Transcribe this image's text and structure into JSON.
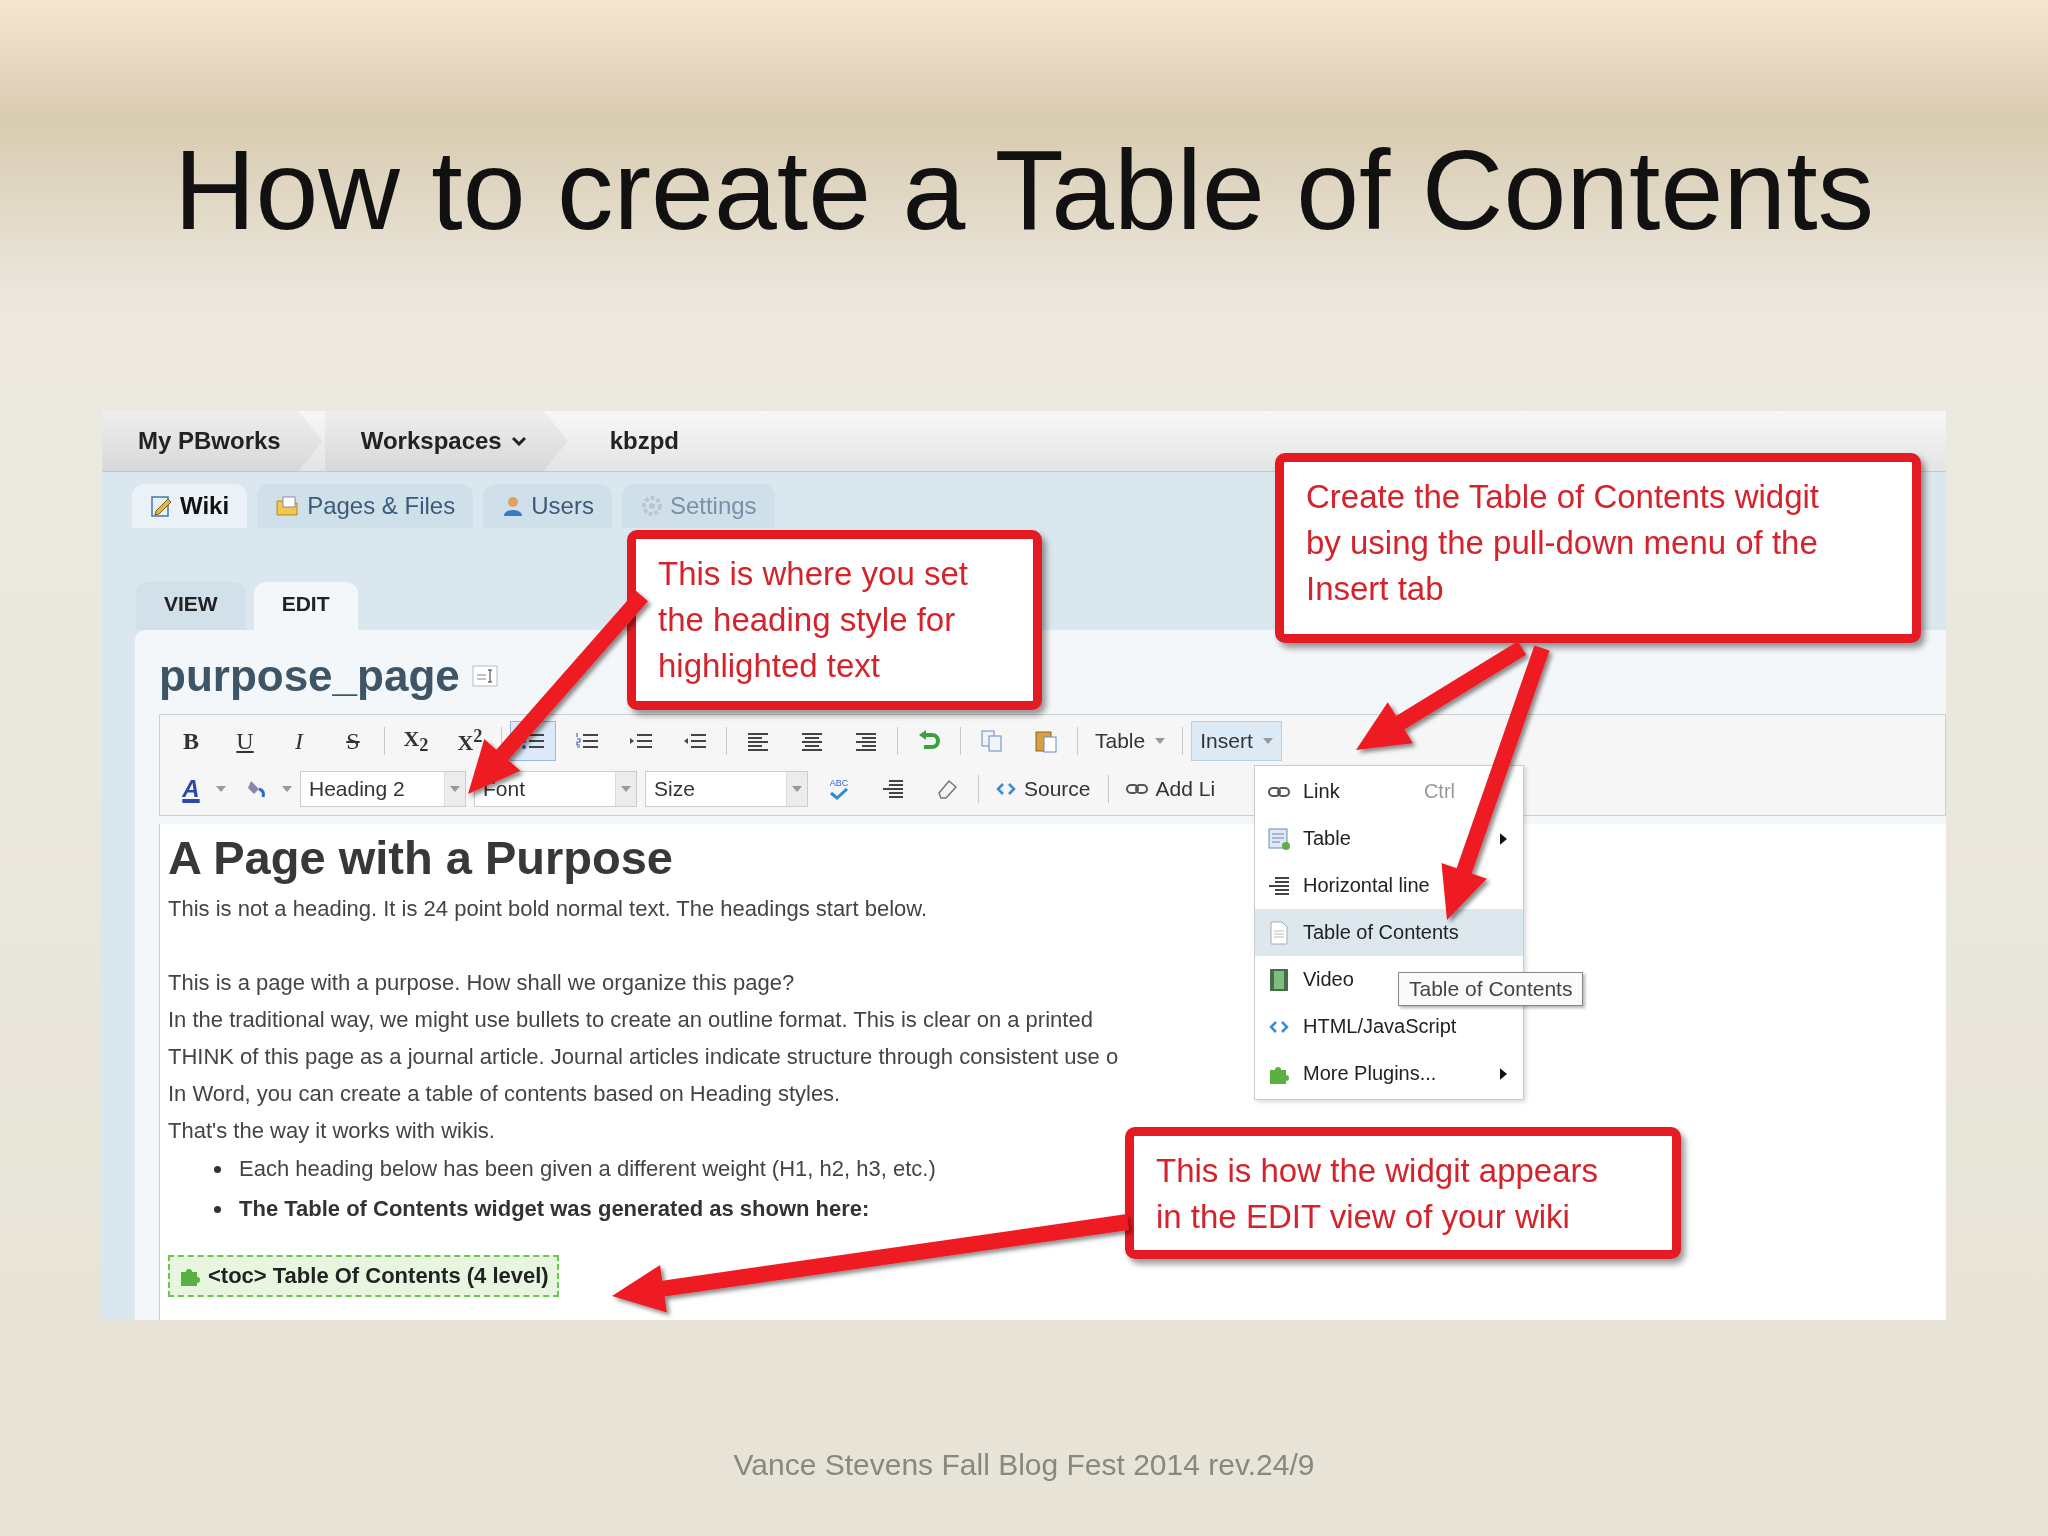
{
  "slide_title": "How to create a Table of Contents",
  "breadcrumbs": [
    {
      "label": "My PBworks",
      "dropdown": false
    },
    {
      "label": "Workspaces",
      "dropdown": true
    },
    {
      "label": "kbzpd",
      "dropdown": false
    }
  ],
  "tabs": [
    {
      "label": "Wiki",
      "selected": true
    },
    {
      "label": "Pages & Files",
      "selected": false
    },
    {
      "label": "Users",
      "selected": false
    },
    {
      "label": "Settings",
      "selected": false
    }
  ],
  "mode_tabs": [
    {
      "label": "VIEW",
      "selected": false
    },
    {
      "label": "EDIT",
      "selected": true
    }
  ],
  "page_title": "purpose_page",
  "toolbar": {
    "format_buttons": [
      {
        "label": "B"
      },
      {
        "label": "U"
      },
      {
        "label": "I"
      },
      {
        "label": "S"
      },
      {
        "label": "X$_{2}$"
      },
      {
        "label": "X$^{2}$"
      }
    ],
    "list_buttons": [
      {
        "selected": true
      },
      {
        "selected": false
      },
      {
        "selected": false
      },
      {
        "selected": false
      }
    ],
    "table_menu": "Table",
    "insert_button": {
      "label": "Insert",
      "expanded": true
    },
    "font_color_button": "A",
    "style_select": "Heading 2",
    "font_select": "Font",
    "size_select": "Size",
    "spellcheck_label": "ABC",
    "source_button": "Source",
    "add_link_button": "Add Li"
  },
  "insert_menu": [
    {
      "label": "Link",
      "shortcut": "Ctrl",
      "submenu": false,
      "selected": false
    },
    {
      "label": "Table",
      "submenu": true,
      "selected": false
    },
    {
      "label": "Horizontal line",
      "submenu": false,
      "selected": false
    },
    {
      "label": "Table of Contents",
      "submenu": false,
      "selected": true
    },
    {
      "label": "Video",
      "submenu": false,
      "selected": false
    },
    {
      "label": "HTML/JavaScript",
      "submenu": false,
      "selected": false
    },
    {
      "label": "More Plugins...",
      "submenu": true,
      "selected": false
    }
  ],
  "tooltip": "Table of Contents",
  "editor": {
    "heading": "A Page with a Purpose",
    "intro": "This is not a heading. It is 24 point bold normal text. The headings start below.",
    "lines": [
      "This is a page with a purpose. How shall we organize this page?",
      "In the traditional way, we might use bullets to create an outline format. This is clear on a printed",
      "THINK of this page as a journal article. Journal articles indicate structure through consistent use o",
      "In Word, you can create a table of contents based on Heading styles.",
      "That's the way it works with wikis."
    ],
    "bullets": [
      {
        "text": "Each heading below has been given a different weight (H1, h2, h3, etc.)",
        "bold": false
      },
      {
        "text": "The  Table of Contents widget was generated as shown here:",
        "bold": true
      }
    ],
    "toc_widget": "<toc> Table Of Contents (4 level)"
  },
  "callouts": [
    {
      "text": "This is where you set\nthe heading style for\nhighlighted text"
    },
    {
      "text": "Create the Table of Contents widgit\nby using the pull-down menu of the\nInsert tab"
    },
    {
      "text": "This is how the widgit appears\nin the EDIT view of your wiki"
    }
  ],
  "footer": "Vance Stevens Fall Blog Fest 2014 rev.24/9"
}
